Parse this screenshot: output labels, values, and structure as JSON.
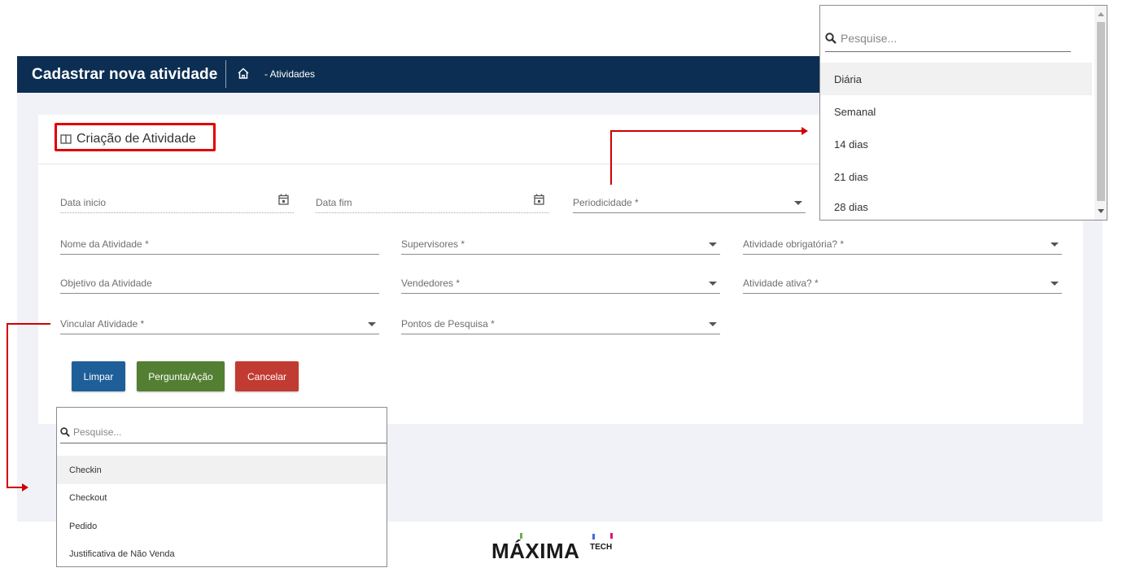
{
  "header": {
    "title": "Cadastrar nova atividade",
    "breadcrumb": "- Atividades"
  },
  "card": {
    "title": "Criação de Atividade"
  },
  "fields": {
    "data_inicio": "Data inicio",
    "data_fim": "Data fim",
    "periodicidade": "Periodicidade *",
    "nome_atividade": "Nome da Atividade *",
    "supervisores": "Supervisores *",
    "atividade_obrigatoria": "Atividade obrigatória? *",
    "objetivo_atividade": "Objetivo da Atividade",
    "vendedores": "Vendedores *",
    "atividade_ativa": "Atividade ativa? *",
    "vincular_atividade": "Vincular Atividade *",
    "pontos_pesquisa": "Pontos de Pesquisa *"
  },
  "buttons": {
    "limpar": "Limpar",
    "pergunta_acao": "Pergunta/Ação",
    "cancelar": "Cancelar"
  },
  "periodicidade_dropdown": {
    "search_placeholder": "Pesquise...",
    "options": [
      "Diária",
      "Semanal",
      "14 dias",
      "21 dias",
      "28 dias"
    ]
  },
  "vincular_dropdown": {
    "search_placeholder": "Pesquise...",
    "options": [
      "Checkin",
      "Checkout",
      "Pedido",
      "Justificativa de Não Venda"
    ]
  },
  "logo": {
    "name": "MÁXIMA",
    "suffix": "TECH"
  },
  "colors": {
    "topbar": "#0c2e52",
    "limpar": "#1f5f99",
    "pergunta": "#537f33",
    "cancelar": "#c13b32",
    "annotation": "#e00000"
  },
  "icons": {
    "home": "home-icon",
    "book": "book-icon",
    "calendar": "calendar-icon",
    "search": "search-icon",
    "dropdown": "caret-down-icon"
  }
}
